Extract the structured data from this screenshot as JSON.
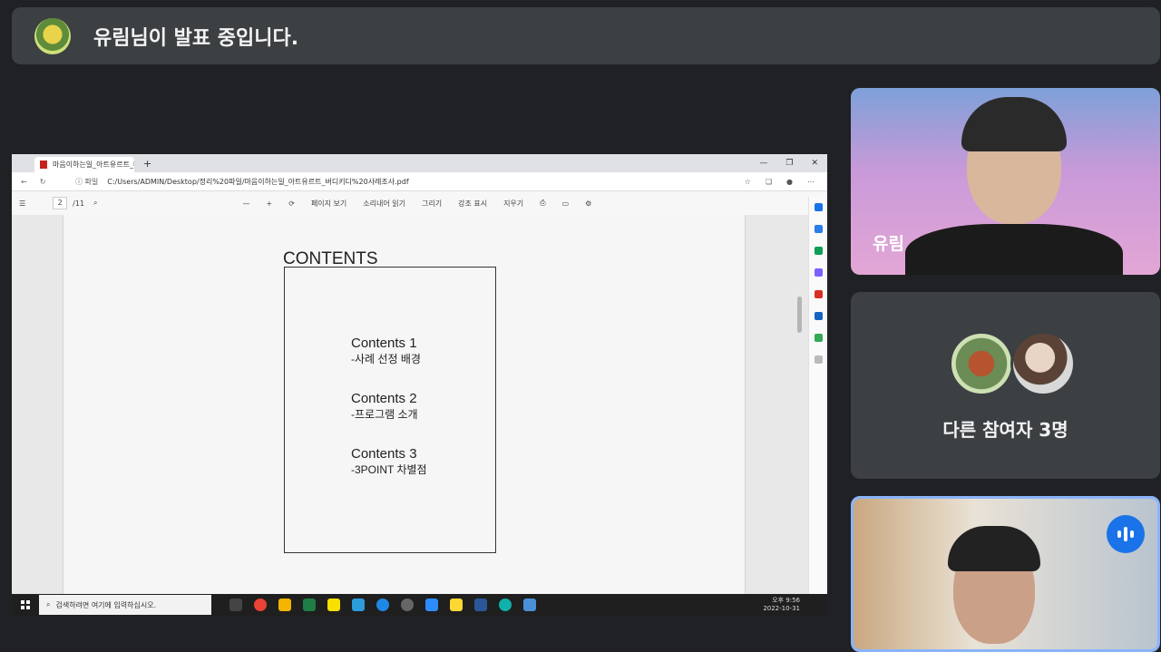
{
  "banner": {
    "text": "유림님이 발표 중입니다."
  },
  "browser": {
    "tab_title": "마음이하는일_아트유르트_버디",
    "address_prefix": "ⓘ 파일",
    "address": "C:/Users/ADMIN/Desktop/정리%20파일/마음이하는일_아트유르트_버디키디%20사례조사.pdf"
  },
  "pdf_toolbar": {
    "page": "2",
    "page_count": "/11",
    "page_view": "페이지 보기",
    "read_aloud": "소리내어 읽기",
    "draw": "그리기",
    "highlight": "강조 표시",
    "erase": "지우기"
  },
  "pdf_page": {
    "title": "CONTENTS",
    "entries": [
      {
        "heading": "Contents 1",
        "sub": "-사례 선정 배경"
      },
      {
        "heading": "Contents 2",
        "sub": "-프로그램 소개"
      },
      {
        "heading": "Contents 3",
        "sub": "-3POINT 차별점"
      }
    ]
  },
  "taskbar": {
    "search_placeholder": "검색하려면 여기에 입력하십시오.",
    "time": "오후 9:56",
    "date": "2022-10-31"
  },
  "participants": {
    "presenter_name": "유림",
    "others_text": "다른 참여자 3명"
  },
  "colors": {
    "accent": "#1a73e8",
    "tile_bg": "#3c4043",
    "page_bg": "#202124"
  }
}
